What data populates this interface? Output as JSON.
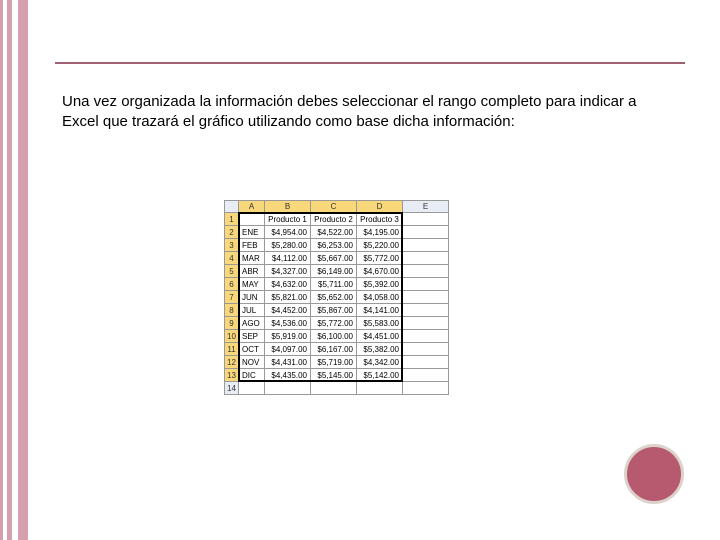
{
  "text": {
    "body": "Una vez organizada la información debes seleccionar el rango completo para indicar a Excel que trazará el gráfico utilizando como base dicha información:"
  },
  "sheet": {
    "cols": [
      "A",
      "B",
      "C",
      "D",
      "E"
    ],
    "headers": [
      "",
      "Producto 1",
      "Producto 2",
      "Producto 3"
    ],
    "rows": [
      {
        "n": 1,
        "month": "",
        "p1": "",
        "p2": "",
        "p3": "",
        "header": true
      },
      {
        "n": 2,
        "month": "ENE",
        "p1": "$4,954.00",
        "p2": "$4,522.00",
        "p3": "$4,195.00"
      },
      {
        "n": 3,
        "month": "FEB",
        "p1": "$5,280.00",
        "p2": "$6,253.00",
        "p3": "$5,220.00"
      },
      {
        "n": 4,
        "month": "MAR",
        "p1": "$4,112.00",
        "p2": "$5,667.00",
        "p3": "$5,772.00"
      },
      {
        "n": 5,
        "month": "ABR",
        "p1": "$4,327.00",
        "p2": "$6,149.00",
        "p3": "$4,670.00"
      },
      {
        "n": 6,
        "month": "MAY",
        "p1": "$4,632.00",
        "p2": "$5,711.00",
        "p3": "$5,392.00"
      },
      {
        "n": 7,
        "month": "JUN",
        "p1": "$5,821.00",
        "p2": "$5,652.00",
        "p3": "$4,058.00"
      },
      {
        "n": 8,
        "month": "JUL",
        "p1": "$4,452.00",
        "p2": "$5,867.00",
        "p3": "$4,141.00"
      },
      {
        "n": 9,
        "month": "AGO",
        "p1": "$4,536.00",
        "p2": "$5,772.00",
        "p3": "$5,583.00"
      },
      {
        "n": 10,
        "month": "SEP",
        "p1": "$5,919.00",
        "p2": "$6,100.00",
        "p3": "$4,451.00"
      },
      {
        "n": 11,
        "month": "OCT",
        "p1": "$4,097.00",
        "p2": "$6,167.00",
        "p3": "$5,382.00"
      },
      {
        "n": 12,
        "month": "NOV",
        "p1": "$4,431.00",
        "p2": "$5,719.00",
        "p3": "$4,342.00"
      },
      {
        "n": 13,
        "month": "DIC",
        "p1": "$4,435.00",
        "p2": "$5,145.00",
        "p3": "$5,142.00"
      },
      {
        "n": 14,
        "month": "",
        "p1": "",
        "p2": "",
        "p3": "",
        "empty": true
      }
    ]
  }
}
